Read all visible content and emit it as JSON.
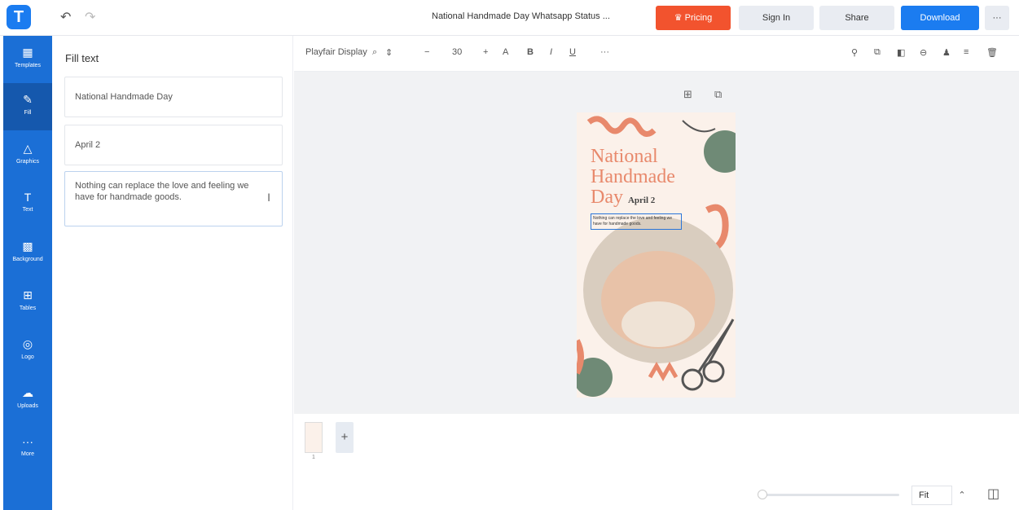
{
  "app": {
    "logo": "T"
  },
  "topbar": {
    "title": "National Handmade Day Whatsapp Status ...",
    "pricing": "Pricing",
    "signin": "Sign In",
    "share": "Share",
    "download": "Download",
    "more": "···"
  },
  "nav": [
    {
      "label": "Templates",
      "icon": "templates-icon"
    },
    {
      "label": "Fill",
      "icon": "pen-icon"
    },
    {
      "label": "Graphics",
      "icon": "shapes-icon"
    },
    {
      "label": "Text",
      "icon": "text-icon"
    },
    {
      "label": "Background",
      "icon": "background-icon"
    },
    {
      "label": "Tables",
      "icon": "table-icon"
    },
    {
      "label": "Logo",
      "icon": "logo-icon"
    },
    {
      "label": "Uploads",
      "icon": "upload-icon"
    },
    {
      "label": "More",
      "icon": "more-icon"
    }
  ],
  "panel": {
    "title": "Fill text",
    "fields": [
      "National Handmade Day",
      "April 2",
      "Nothing can replace the love and feeling we have for handmade goods."
    ]
  },
  "toolbar": {
    "font": "Playfair Display",
    "size": "30",
    "more": "···"
  },
  "design": {
    "title": "National Handmade Day",
    "title_line1": "National",
    "title_line2": "Handmade",
    "title_line3": "Day",
    "date": "April 2",
    "body": "Nothing can replace the love and feeling we have for handmade goods."
  },
  "pages": {
    "current": "1"
  },
  "zoom": {
    "label": "Fit"
  },
  "colors": {
    "primary": "#1b7cf0",
    "pricing": "#f2532e",
    "nav": "#1b6fd6",
    "accent": "#e8896c"
  }
}
